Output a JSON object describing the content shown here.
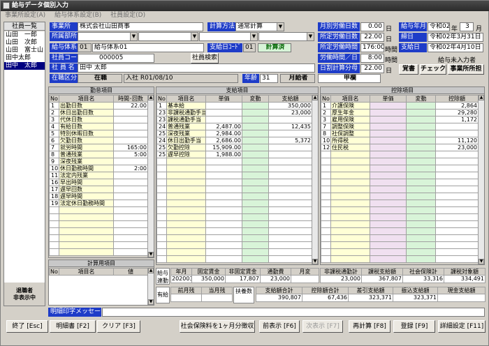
{
  "title": "給与データ個別入力",
  "menu": [
    "事業所設定(A)",
    "給与体系設定(B)",
    "社員設定(D)"
  ],
  "employee_list": {
    "header": "社員一覧",
    "items": [
      "山田　一郎",
      "山田　次郎",
      "山田　富士山",
      "田中太郎",
      "田中　太郎"
    ],
    "footer": "退職者\n非表示中"
  },
  "form": {
    "office_label": "事業所",
    "office_value": "株式会社山田商事",
    "calc_method_label": "計算方法",
    "calc_method_value": "通常計算",
    "dept_label": "所属部所",
    "pay_system_label": "給与体系",
    "pay_system_code": "01",
    "pay_system_name": "給与体系01",
    "payday_code_label": "支給日ｺｰﾄﾞ",
    "payday_code": "01",
    "calc_status": "計算済",
    "emp_code_label": "社員コード",
    "emp_code": "000005",
    "search_button": "社員検索",
    "emp_name_label": "社 員 名",
    "emp_name": "田中 太郎",
    "class_label": "在職区分",
    "class_value": "在職",
    "hire": "入社 R01/08/10",
    "age_label": "年齢",
    "age": "31",
    "pay_type": "月給者",
    "column_label": "甲欄"
  },
  "right_form": {
    "monthly_days_label": "月別労働日数",
    "monthly_days": "0.00",
    "unit_day": "日",
    "scheduled_days_label": "所定労働日数",
    "scheduled_days": "22.00",
    "scheduled_time_label": "所定労働時間",
    "scheduled_time": "176:00",
    "unit_time": "時間",
    "work_hours_label": "労働時間／日",
    "work_hours": "8:00",
    "daily_min_label": "日割計算分母",
    "daily_min": "22.00",
    "pay_year_label": "給与年月",
    "era": "令和02",
    "year_unit": "年",
    "month": "3",
    "month_unit": "月",
    "close_label": "締日",
    "close_date": "令和02年3月31日",
    "pay_date_label": "支給日",
    "pay_date": "令和02年4月10日",
    "not_entered": "給与未入力者",
    "btn_memo": "覚書",
    "btn_check": "チェック",
    "btn_office": "事業所所担"
  },
  "attendance": {
    "title": "勤怠項目",
    "cols": [
      "No",
      "項目名",
      "時間･回数"
    ],
    "rows": [
      [
        "1",
        "出勤日数",
        "22.00"
      ],
      [
        "2",
        "休日出勤日数",
        ""
      ],
      [
        "3",
        "代休日数",
        ""
      ],
      [
        "4",
        "有給日数",
        ""
      ],
      [
        "5",
        "特別休暇日数",
        ""
      ],
      [
        "6",
        "欠勤日数",
        ""
      ],
      [
        "7",
        "就労時間",
        "165:00"
      ],
      [
        "8",
        "普通残業",
        "5:00"
      ],
      [
        "9",
        "深夜残業",
        ""
      ],
      [
        "10",
        "休日勤務時間",
        "2:00"
      ],
      [
        "11",
        "法定内残業",
        ""
      ],
      [
        "16",
        "早出時間",
        ""
      ],
      [
        "17",
        "遅早回数",
        ""
      ],
      [
        "18",
        "遅早時間",
        ""
      ],
      [
        "19",
        "法定休日勤務時間",
        ""
      ]
    ]
  },
  "calc": {
    "title": "計算用項目",
    "cols": [
      "No",
      "項目名",
      "値"
    ]
  },
  "payment": {
    "title": "支給項目",
    "cols": [
      "No",
      "項目名",
      "単価",
      "変動",
      "支給額"
    ],
    "rows": [
      [
        "1",
        "基本給",
        "",
        "",
        "350,000"
      ],
      [
        "23",
        "非課税通勤手当",
        "",
        "",
        "23,000"
      ],
      [
        "23",
        "課税通勤手当",
        "",
        "",
        ""
      ],
      [
        "24",
        "普通残業",
        "2,487.00",
        "",
        "12,435"
      ],
      [
        "25",
        "深夜残業",
        "2,984.00",
        "",
        ""
      ],
      [
        "24",
        "休日出勤手当",
        "2,686.00",
        "",
        "5,372"
      ],
      [
        "25",
        "欠勤控除",
        "15,909.00",
        "",
        ""
      ],
      [
        "25",
        "遅早控除",
        "1,988.00",
        "",
        ""
      ]
    ]
  },
  "deduction": {
    "title": "控除項目",
    "cols": [
      "No",
      "項目名",
      "単価",
      "変動",
      "控除額"
    ],
    "rows": [
      [
        "1",
        "介護保険",
        "",
        "",
        "2,864"
      ],
      [
        "2",
        "厚生年金",
        "",
        "",
        "29,280"
      ],
      [
        "3",
        "雇用保険",
        "",
        "",
        "1,172"
      ],
      [
        "7",
        "調整保険",
        "",
        "",
        ""
      ],
      [
        "8",
        "社保調整",
        "",
        "",
        ""
      ],
      [
        "10",
        "所得税",
        "",
        "",
        "11,120"
      ],
      [
        "12",
        "住民税",
        "",
        "",
        "23,000"
      ]
    ]
  },
  "linkage": {
    "label": "給与連動",
    "cols": [
      "年月",
      "固定賃金",
      "非固定賃金",
      "通勤費",
      "月変"
    ],
    "vals": [
      "202003",
      "350,000",
      "17,807",
      "23,000",
      ""
    ]
  },
  "yuukyu": {
    "label": "有給",
    "cols": [
      "前月残",
      "当月残"
    ],
    "vals": [
      "",
      ""
    ]
  },
  "dependents_label": "扶養数",
  "summary1": {
    "cols": [
      "非課税通勤計",
      "課税支給額",
      "社会保険計",
      "課税対象額"
    ],
    "vals": [
      "23,000",
      "367,807",
      "33,316",
      "334,491"
    ]
  },
  "summary2": {
    "cols": [
      "支給額合計",
      "控除額合計",
      "差引支給額",
      "振込支給額",
      "現金支給額"
    ],
    "vals": [
      "390,807",
      "67,436",
      "323,371",
      "323,371",
      ""
    ]
  },
  "message_label": "明細印字メッセージ",
  "footer_buttons": [
    "終了 [Esc]",
    "明細書 [F2]",
    "クリア [F3]",
    "社会保険料を1ヶ月分徴収",
    "前表示 [F6]",
    "次表示 [F7]",
    "再計算 [F8]",
    "登録 [F9]",
    "詳細設定 [F11]"
  ]
}
